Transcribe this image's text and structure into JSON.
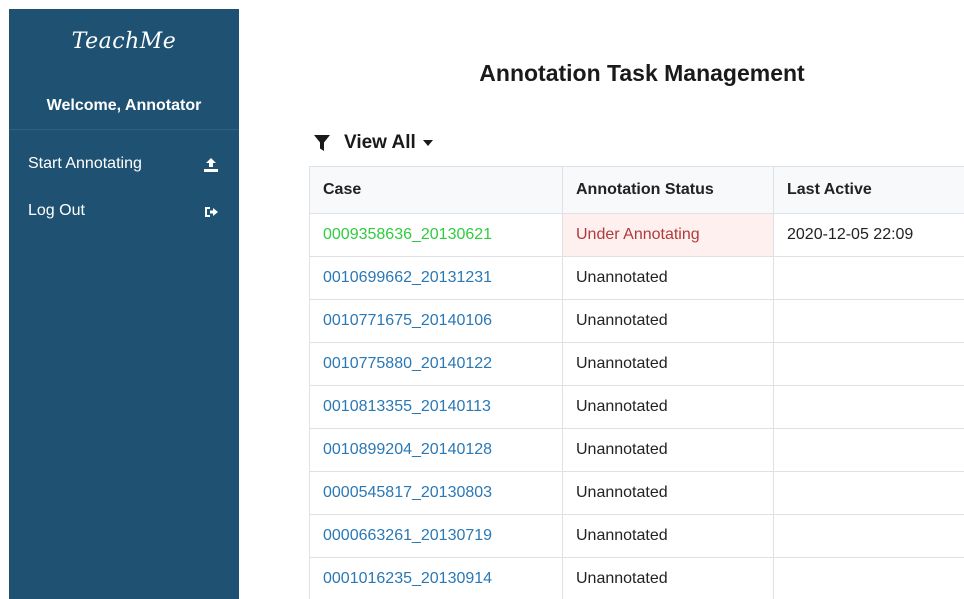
{
  "sidebar": {
    "logo_text": "TeachMe",
    "welcome": "Welcome, Annotator",
    "items": [
      {
        "label": "Start Annotating",
        "icon": "upload-icon"
      },
      {
        "label": "Log Out",
        "icon": "sign-out-icon"
      }
    ]
  },
  "main": {
    "title": "Annotation Task Management",
    "filter": {
      "label": "View All",
      "icon": "filter-icon"
    },
    "table": {
      "headers": [
        "Case",
        "Annotation Status",
        "Last Active"
      ],
      "rows": [
        {
          "case": "0009358636_20130621",
          "status": "Under Annotating",
          "last_active": "2020-12-05 22:09"
        },
        {
          "case": "0010699662_20131231",
          "status": "Unannotated",
          "last_active": ""
        },
        {
          "case": "0010771675_20140106",
          "status": "Unannotated",
          "last_active": ""
        },
        {
          "case": "0010775880_20140122",
          "status": "Unannotated",
          "last_active": ""
        },
        {
          "case": "0010813355_20140113",
          "status": "Unannotated",
          "last_active": ""
        },
        {
          "case": "0010899204_20140128",
          "status": "Unannotated",
          "last_active": ""
        },
        {
          "case": "0000545817_20130803",
          "status": "Unannotated",
          "last_active": ""
        },
        {
          "case": "0000663261_20130719",
          "status": "Unannotated",
          "last_active": ""
        },
        {
          "case": "0001016235_20130914",
          "status": "Unannotated",
          "last_active": ""
        }
      ]
    }
  },
  "colors": {
    "sidebar_bg": "#1f5272",
    "link": "#2a78b5",
    "active_case": "#2ecc40",
    "active_status_text": "#b23a3a",
    "active_status_bg": "#fdf0ef"
  }
}
